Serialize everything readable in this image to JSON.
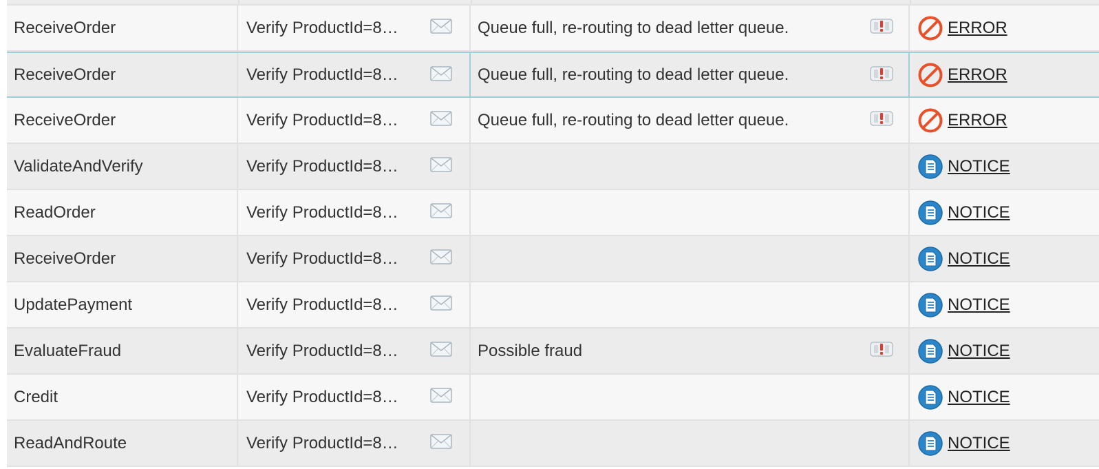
{
  "rows": [
    {
      "step": "ReceiveOrder",
      "condition": "Verify ProductId=8…",
      "message": "Queue full, re-routing to dead letter queue.",
      "has_alert": true,
      "level": "ERROR",
      "level_icon": "error-icon"
    },
    {
      "step": "ReceiveOrder",
      "condition": "Verify ProductId=8…",
      "message": "Queue full, re-routing to dead letter queue.",
      "has_alert": true,
      "level": "ERROR",
      "level_icon": "error-icon"
    },
    {
      "step": "ReceiveOrder",
      "condition": "Verify ProductId=8…",
      "message": "Queue full, re-routing to dead letter queue.",
      "has_alert": true,
      "level": "ERROR",
      "level_icon": "error-icon"
    },
    {
      "step": "ValidateAndVerify",
      "condition": "Verify ProductId=8…",
      "message": "",
      "has_alert": false,
      "level": "NOTICE",
      "level_icon": "notice-icon"
    },
    {
      "step": "ReadOrder",
      "condition": "Verify ProductId=8…",
      "message": "",
      "has_alert": false,
      "level": "NOTICE",
      "level_icon": "notice-icon"
    },
    {
      "step": "ReceiveOrder",
      "condition": "Verify ProductId=8…",
      "message": "",
      "has_alert": false,
      "level": "NOTICE",
      "level_icon": "notice-icon"
    },
    {
      "step": "UpdatePayment",
      "condition": "Verify ProductId=8…",
      "message": "",
      "has_alert": false,
      "level": "NOTICE",
      "level_icon": "notice-icon"
    },
    {
      "step": "EvaluateFraud",
      "condition": "Verify ProductId=8…",
      "message": "Possible fraud",
      "has_alert": true,
      "level": "NOTICE",
      "level_icon": "notice-icon"
    },
    {
      "step": "Credit",
      "condition": "Verify ProductId=8…",
      "message": "",
      "has_alert": false,
      "level": "NOTICE",
      "level_icon": "notice-icon"
    },
    {
      "step": "ReadAndRoute",
      "condition": "Verify ProductId=8…",
      "message": "",
      "has_alert": false,
      "level": "NOTICE",
      "level_icon": "notice-icon"
    }
  ],
  "selected_row": 1,
  "colors": {
    "error": "#e8502a",
    "notice": "#2a86c9",
    "row_odd": "#f7f7f7",
    "row_even": "#ececec",
    "selection_border": "#9fcfd9"
  },
  "icons": {
    "message": "envelope-icon",
    "alert": "alert-icon"
  }
}
